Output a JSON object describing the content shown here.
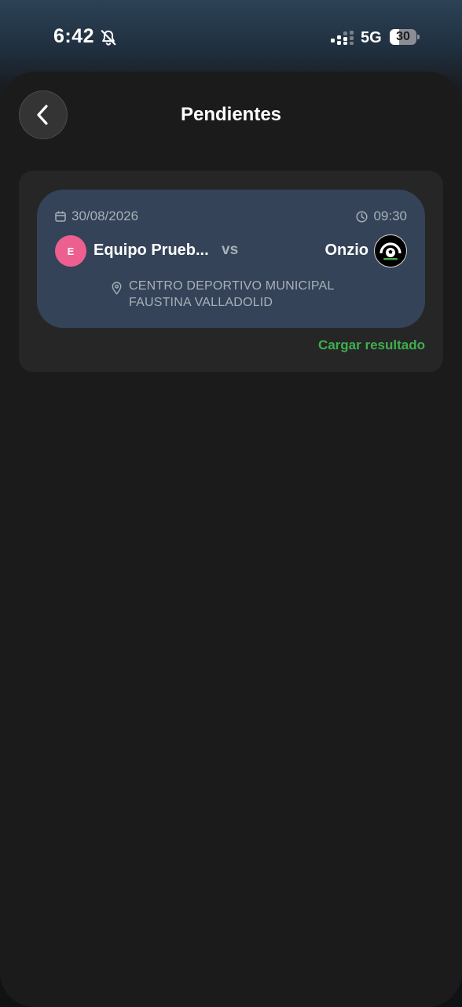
{
  "status_bar": {
    "time": "6:42",
    "network": "5G",
    "battery": "30",
    "icons": [
      "bell-muted-icon",
      "signal-icon",
      "battery-icon"
    ]
  },
  "header": {
    "title": "Pendientes",
    "back_icon": "chevron-left-icon"
  },
  "match": {
    "date": "30/08/2026",
    "time": "09:30",
    "home_initial": "E",
    "home_name": "Equipo Prueb...",
    "vs": "vs",
    "away_name": "Onzio",
    "location_line1": "CENTRO DEPORTIVO MUNICIPAL",
    "location_line2": "FAUSTINA VALLADOLID",
    "action_label": "Cargar resultado"
  },
  "colors": {
    "card": "#344357",
    "accent_green": "#3fae4f",
    "avatar_pink": "#ec5f8f"
  }
}
